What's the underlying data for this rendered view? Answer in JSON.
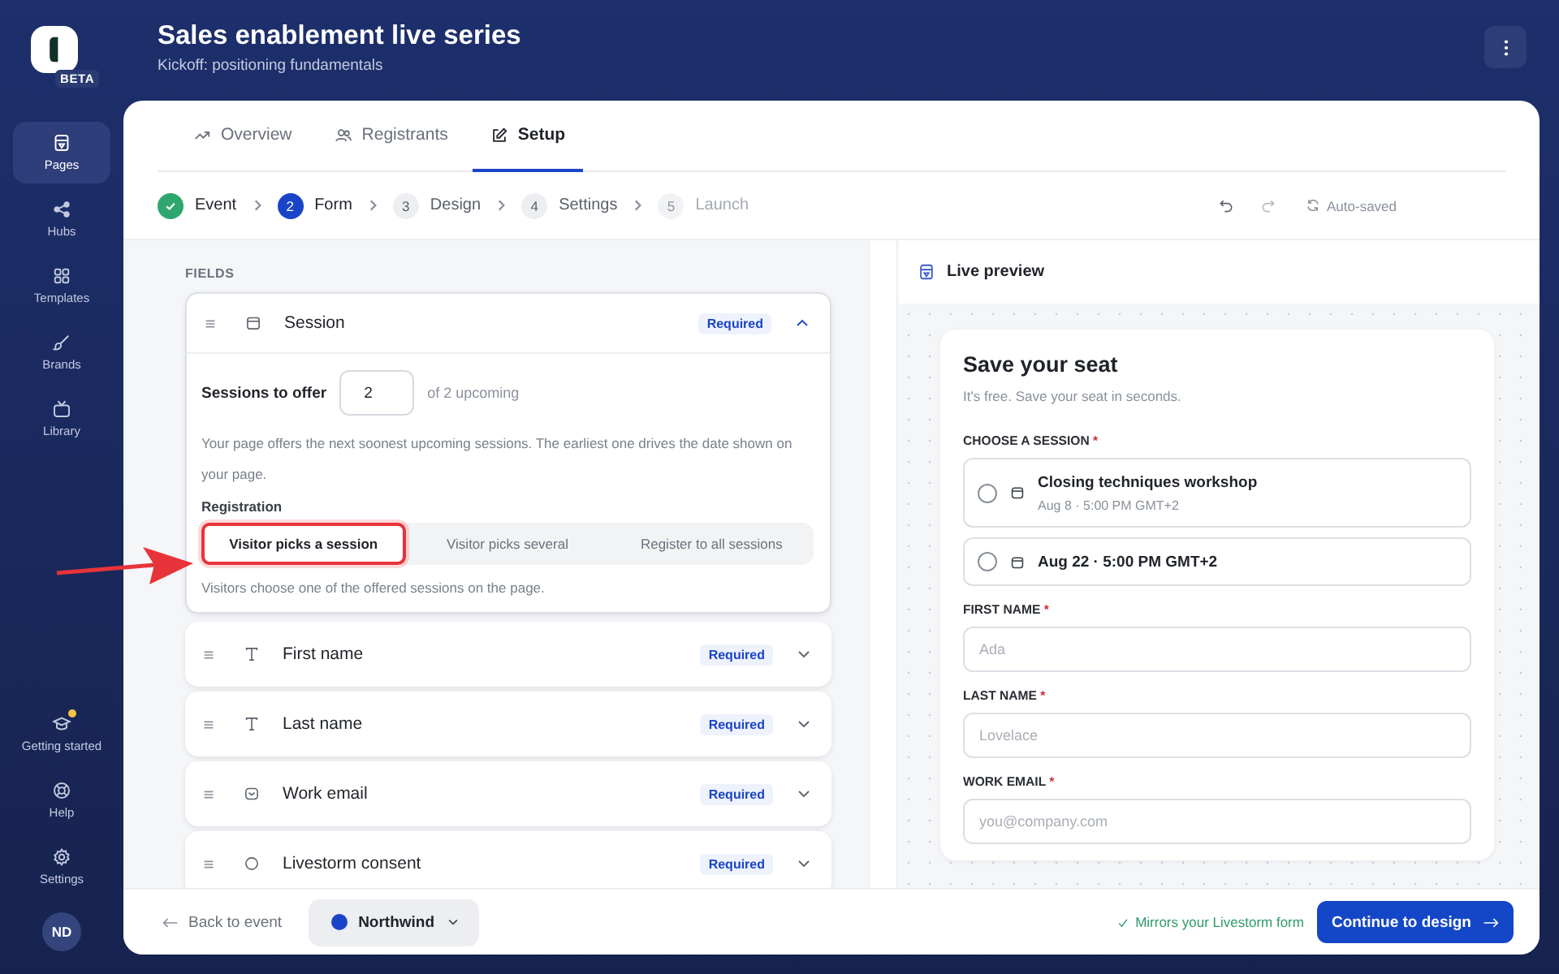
{
  "sidebar": {
    "badge": "BETA",
    "items": [
      {
        "label": "Pages",
        "selected": true
      },
      {
        "label": "Hubs",
        "selected": false
      },
      {
        "label": "Templates",
        "selected": false
      },
      {
        "label": "Brands",
        "selected": false
      },
      {
        "label": "Library",
        "selected": false
      }
    ],
    "bottom_items": [
      {
        "label": "Getting started",
        "notification": true
      },
      {
        "label": "Help",
        "notification": false
      },
      {
        "label": "Settings",
        "notification": false
      }
    ],
    "avatar": "ND"
  },
  "header": {
    "title": "Sales enablement live series",
    "subtitle": "Kickoff: positioning fundamentals"
  },
  "tabs": [
    {
      "label": "Overview",
      "selected": false
    },
    {
      "label": "Registrants",
      "selected": false
    },
    {
      "label": "Setup",
      "selected": true
    }
  ],
  "steps": [
    {
      "label": "Event",
      "completed": true,
      "selected": false,
      "disabled": false
    },
    {
      "number": "2",
      "label": "Form",
      "completed": false,
      "selected": true,
      "disabled": false
    },
    {
      "number": "3",
      "label": "Design",
      "completed": false,
      "selected": false,
      "disabled": false
    },
    {
      "number": "4",
      "label": "Settings",
      "completed": false,
      "selected": false,
      "disabled": false
    },
    {
      "number": "5",
      "label": "Launch",
      "completed": false,
      "selected": false,
      "disabled": true
    }
  ],
  "save_status": "Auto-saved",
  "fields": {
    "heading": "FIELDS",
    "items": [
      {
        "kind": "session",
        "label": "Session",
        "badge": "Required",
        "expanded": true
      },
      {
        "kind": "text",
        "label": "First name",
        "badge": "Required",
        "expanded": false
      },
      {
        "kind": "text",
        "label": "Last name",
        "badge": "Required",
        "expanded": false
      },
      {
        "kind": "email",
        "label": "Work email",
        "badge": "Required",
        "expanded": false
      },
      {
        "kind": "consent",
        "label": "Livestorm consent",
        "badge": "Required",
        "expanded": false
      }
    ],
    "session_settings": {
      "offer_label": "Sessions to offer",
      "offer_value": "2",
      "offer_suffix": "of 2 upcoming",
      "description": "Your page offers the next soonest upcoming sessions. The earliest one drives the date shown on your page.",
      "registration_label": "Registration",
      "options": [
        {
          "label": "Visitor picks a session",
          "selected": true
        },
        {
          "label": "Visitor picks several",
          "selected": false
        },
        {
          "label": "Register to all sessions",
          "selected": false
        }
      ],
      "note": "Visitors choose one of the offered sessions on the page."
    }
  },
  "preview": {
    "title": "Live preview",
    "heading": "Save your seat",
    "subheading": "It's free. Save your seat in seconds.",
    "session_label": "CHOOSE A SESSION",
    "session_mark": "*",
    "sessions": [
      {
        "title": "Closing techniques workshop",
        "time": "Aug 8 · 5:00 PM GMT+2",
        "selected": false
      },
      {
        "title": "Aug 22 · 5:00 PM GMT+2",
        "selected": false
      }
    ],
    "inputs": [
      {
        "label": "FIRST NAME",
        "mark": "*",
        "placeholder": "Ada"
      },
      {
        "label": "LAST NAME",
        "mark": "*",
        "placeholder": "Lovelace"
      },
      {
        "label": "WORK EMAIL",
        "mark": "*",
        "placeholder": "you@company.com"
      }
    ]
  },
  "footer": {
    "back": "Back to event",
    "workspace": {
      "label": "Northwind",
      "color": "#1a44c8"
    },
    "note": "Mirrors your Livestorm form",
    "primary": "Continue to design"
  }
}
